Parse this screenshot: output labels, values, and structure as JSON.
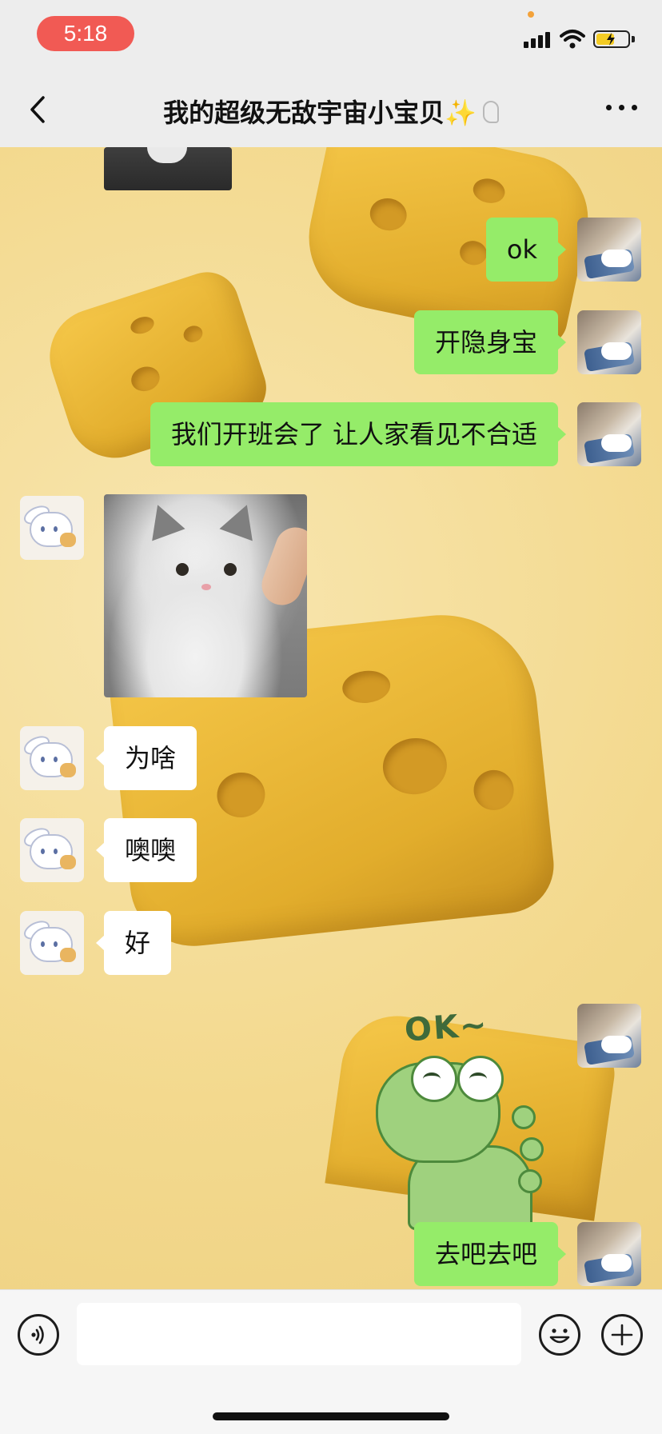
{
  "status_bar": {
    "time": "5:18"
  },
  "header": {
    "title": "我的超级无敌宇宙小宝贝",
    "title_emoji": "✨"
  },
  "messages": [
    {
      "direction": "incoming",
      "type": "image",
      "description_name": "cat-photo-partial"
    },
    {
      "direction": "outgoing",
      "type": "text",
      "text": "ok"
    },
    {
      "direction": "outgoing",
      "type": "text",
      "text": "开隐身宝"
    },
    {
      "direction": "outgoing",
      "type": "text",
      "text": "我们开班会了 让人家看见不合适"
    },
    {
      "direction": "incoming",
      "type": "image",
      "description_name": "cat-photo"
    },
    {
      "direction": "incoming",
      "type": "text",
      "text": "为啥"
    },
    {
      "direction": "incoming",
      "type": "text",
      "text": "噢噢"
    },
    {
      "direction": "incoming",
      "type": "text",
      "text": "好"
    },
    {
      "direction": "outgoing",
      "type": "sticker",
      "text": "OK~"
    },
    {
      "direction": "outgoing",
      "type": "text",
      "text": "去吧去吧"
    }
  ],
  "input": {
    "value": "",
    "placeholder": ""
  },
  "icons": {
    "back": "chevron-left-icon",
    "more": "more-dots-icon",
    "voice": "voice-icon",
    "emoji": "emoji-icon",
    "plus": "plus-icon",
    "ear": "ear-icon"
  },
  "colors": {
    "outgoing_bubble": "#95ec69",
    "incoming_bubble": "#ffffff",
    "time_pill": "#f15a54",
    "nav_bg": "#ededed"
  }
}
